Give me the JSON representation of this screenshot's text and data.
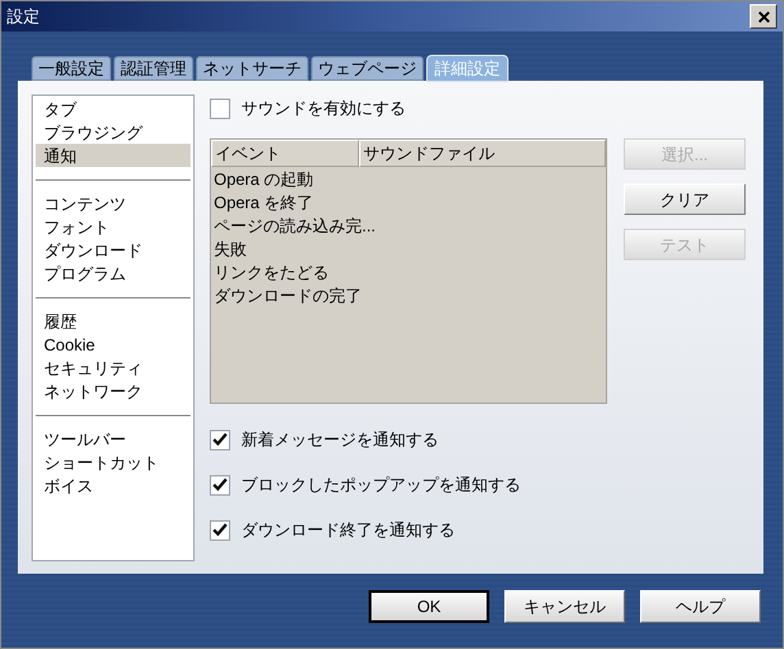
{
  "window": {
    "title": "設定"
  },
  "tabs": [
    {
      "label": "一般設定",
      "selected": false
    },
    {
      "label": "認証管理",
      "selected": false
    },
    {
      "label": "ネットサーチ",
      "selected": false
    },
    {
      "label": "ウェブページ",
      "selected": false
    },
    {
      "label": "詳細設定",
      "selected": true
    }
  ],
  "sidebar": {
    "groups": [
      {
        "items": [
          {
            "label": "タブ",
            "selected": false
          },
          {
            "label": "ブラウジング",
            "selected": false
          },
          {
            "label": "通知",
            "selected": true
          }
        ]
      },
      {
        "items": [
          {
            "label": "コンテンツ",
            "selected": false
          },
          {
            "label": "フォント",
            "selected": false
          },
          {
            "label": "ダウンロード",
            "selected": false
          },
          {
            "label": "プログラム",
            "selected": false
          }
        ]
      },
      {
        "items": [
          {
            "label": "履歴",
            "selected": false
          },
          {
            "label": "Cookie",
            "selected": false
          },
          {
            "label": "セキュリティ",
            "selected": false
          },
          {
            "label": "ネットワーク",
            "selected": false
          }
        ]
      },
      {
        "items": [
          {
            "label": "ツールバー",
            "selected": false
          },
          {
            "label": "ショートカット",
            "selected": false
          },
          {
            "label": "ボイス",
            "selected": false
          }
        ]
      }
    ]
  },
  "enable_sound": {
    "label": "サウンドを有効にする",
    "checked": false
  },
  "sound_table": {
    "columns": [
      "イベント",
      "サウンドファイル"
    ],
    "rows": [
      "Opera の起動",
      "Opera を終了",
      "ページの読み込み完...",
      "失敗",
      "リンクをたどる",
      "ダウンロードの完了"
    ]
  },
  "side_buttons": [
    {
      "label": "選択...",
      "disabled": true
    },
    {
      "label": "クリア",
      "disabled": false
    },
    {
      "label": "テスト",
      "disabled": true
    }
  ],
  "notify_options": [
    {
      "label": "新着メッセージを通知する",
      "checked": true
    },
    {
      "label": "ブロックしたポップアップを通知する",
      "checked": true
    },
    {
      "label": "ダウンロード終了を通知する",
      "checked": true
    }
  ],
  "buttons": [
    {
      "label": "OK",
      "default": true
    },
    {
      "label": "キャンセル",
      "default": false
    },
    {
      "label": "ヘルプ",
      "default": false
    }
  ]
}
